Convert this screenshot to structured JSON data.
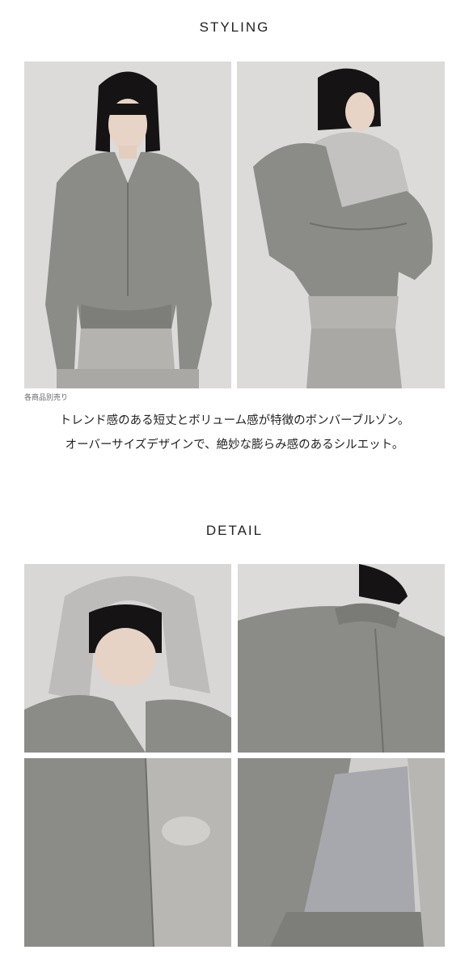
{
  "styling": {
    "title": "STYLING",
    "note": "各商品別売り",
    "description": [
      "トレンド感のある短丈とボリューム感が特徴のボンバーブルゾン。",
      "オーバーサイズデザインで、絶妙な膨らみ感のあるシルエット。"
    ],
    "photos": [
      {
        "icon": "model-front-photo"
      },
      {
        "icon": "model-back-photo"
      }
    ]
  },
  "detail": {
    "title": "DETAIL",
    "photos": [
      {
        "icon": "hood-closeup-photo"
      },
      {
        "icon": "collar-back-closeup-photo"
      },
      {
        "icon": "pocket-closeup-photo"
      },
      {
        "icon": "lining-closeup-photo"
      }
    ]
  },
  "colors": {
    "jacket": "#8a8b86",
    "jacket_dark": "#6f706b",
    "knit": "#b7b6b2",
    "background": "#d9d8d6",
    "hair": "#161414",
    "skin": "#e6d3c6",
    "lining": "#a6a8ad"
  }
}
